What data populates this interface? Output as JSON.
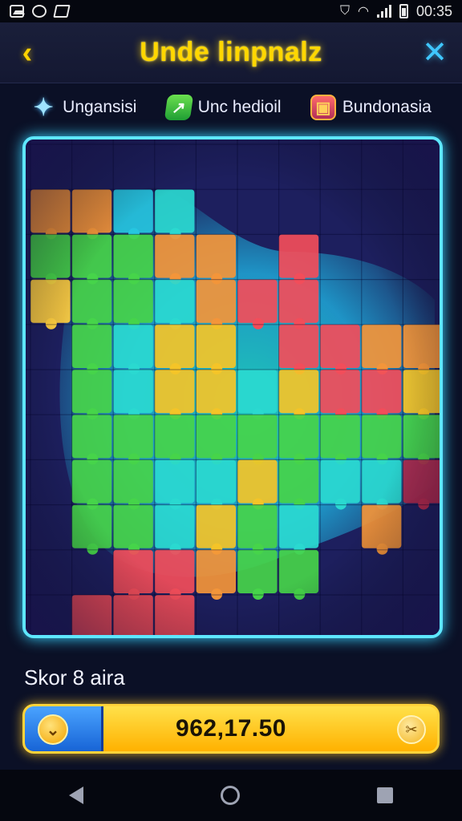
{
  "status_bar": {
    "time": "00:35"
  },
  "header": {
    "title": "Unde linpnalz"
  },
  "categories": [
    {
      "label": "Ungansisi",
      "icon": "sparkle-star-icon"
    },
    {
      "label": "Unc hedioil",
      "icon": "green-shield-icon"
    },
    {
      "label": "Bundonasia",
      "icon": "badge-icon"
    }
  ],
  "score": {
    "label": "Skor 8 aira",
    "value": "962,17.50",
    "progress": 0.19
  },
  "colors": {
    "accent": "#ffd700",
    "board_border": "#5ee7ff",
    "board_bg": "#1b1c55",
    "bar_fill": "#1764d6",
    "bar_bg": "#ffb100"
  }
}
